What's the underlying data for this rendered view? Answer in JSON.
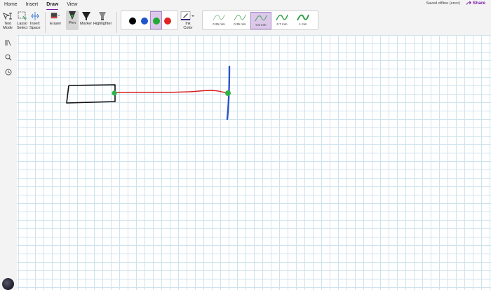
{
  "menu": {
    "tabs": [
      {
        "label": "Home"
      },
      {
        "label": "Insert"
      },
      {
        "label": "Draw"
      },
      {
        "label": "View"
      }
    ]
  },
  "status": {
    "text": "Saved offline (error)"
  },
  "share": {
    "label": "Share"
  },
  "ribbon": {
    "text_mode": {
      "line1": "Text",
      "line2": "Mode"
    },
    "lasso": {
      "line1": "Lasso",
      "line2": "Select"
    },
    "insert_space": {
      "line1": "Insert",
      "line2": "Space"
    },
    "eraser": "Eraser",
    "pen": "Pen",
    "marker": "Marker",
    "highlighter": "Highlighter",
    "colors": [
      "#000000",
      "#2255cc",
      "#22aa33",
      "#e02424"
    ],
    "selected_color_index": 2,
    "ink_color": {
      "line1": "Ink",
      "line2": "Color"
    },
    "thicknesses": [
      "0.25 mm",
      "0.35 mm",
      "0.5 mm",
      "0.7 mm",
      "1 mm"
    ],
    "selected_thickness_index": 2
  },
  "accent": "#7719aa"
}
